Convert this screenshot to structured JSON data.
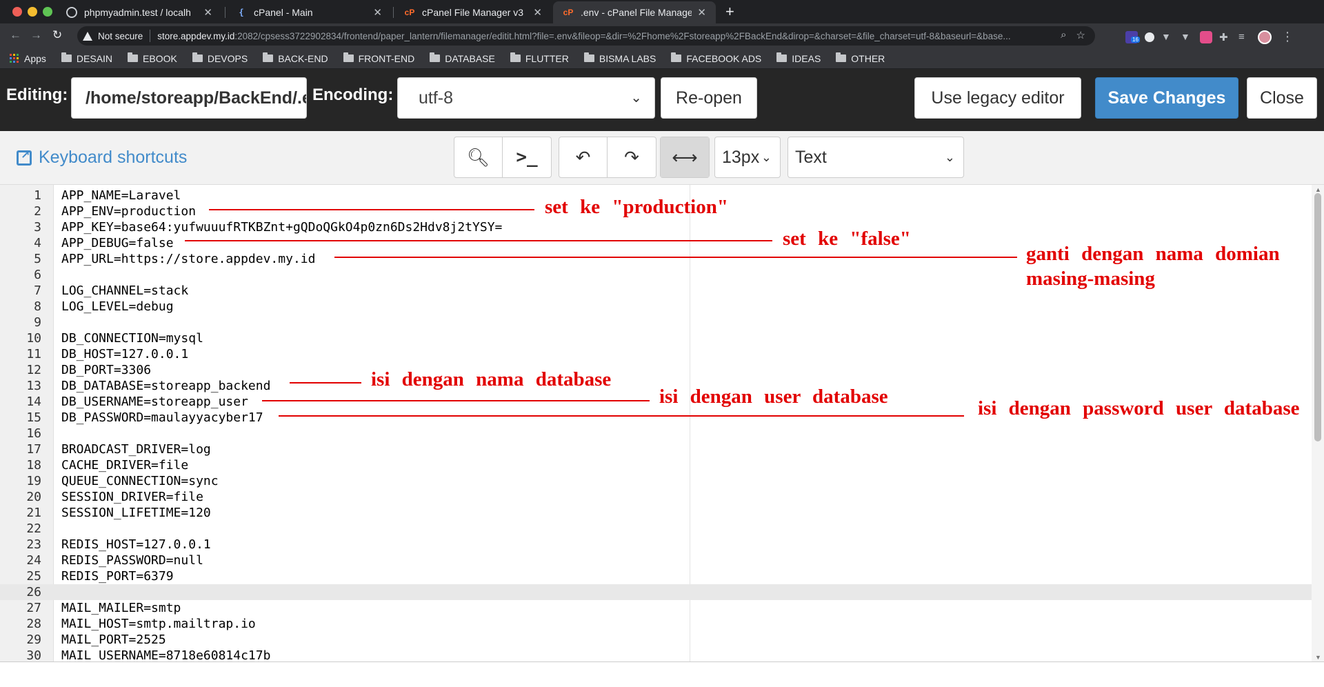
{
  "browser": {
    "tabs": [
      {
        "title": "phpmyadmin.test / localh",
        "icon": "globe-icon"
      },
      {
        "title": "cPanel - Main",
        "icon": "bracket-icon"
      },
      {
        "title": "cPanel File Manager v3",
        "icon": "cpanel-icon"
      },
      {
        "title": ".env - cPanel File Manager",
        "icon": "cpanel-icon",
        "active": true
      }
    ],
    "address": {
      "security": "Not secure",
      "host": "store.appdev.my.id",
      "path": ":2082/cpsess3722902834/frontend/paper_lantern/filemanager/editit.html?file=.env&fileop=&dir=%2Fhome%2Fstoreapp%2FBackEnd&dirop=&charset=&file_charset=utf-8&baseurl=&base..."
    },
    "extension_badge": "16",
    "bookmarks": [
      "Apps",
      "DESAIN",
      "EBOOK",
      "DEVOPS",
      "BACK-END",
      "FRONT-END",
      "DATABASE",
      "FLUTTER",
      "BISMA LABS",
      "FACEBOOK ADS",
      "IDEAS",
      "OTHER"
    ]
  },
  "header": {
    "editing_label": "Editing:",
    "file_path": "/home/storeapp/BackEnd/.env",
    "encoding_label": "Encoding:",
    "encoding_value": "utf-8",
    "reopen": "Re-open",
    "legacy": "Use legacy editor",
    "save": "Save Changes",
    "close": "Close"
  },
  "toolbar": {
    "shortcuts": "Keyboard shortcuts",
    "font_size": "13px",
    "mode": "Text"
  },
  "editor": {
    "active_line": 26,
    "lines": [
      "APP_NAME=Laravel",
      "APP_ENV=production",
      "APP_KEY=base64:yufwuuufRTKBZnt+gQDoQGkO4p0zn6Ds2Hdv8j2tYSY=",
      "APP_DEBUG=false",
      "APP_URL=https://store.appdev.my.id",
      "",
      "LOG_CHANNEL=stack",
      "LOG_LEVEL=debug",
      "",
      "DB_CONNECTION=mysql",
      "DB_HOST=127.0.0.1",
      "DB_PORT=3306",
      "DB_DATABASE=storeapp_backend",
      "DB_USERNAME=storeapp_user",
      "DB_PASSWORD=maulayyacyber17",
      "",
      "BROADCAST_DRIVER=log",
      "CACHE_DRIVER=file",
      "QUEUE_CONNECTION=sync",
      "SESSION_DRIVER=file",
      "SESSION_LIFETIME=120",
      "",
      "REDIS_HOST=127.0.0.1",
      "REDIS_PASSWORD=null",
      "REDIS_PORT=6379",
      "",
      "MAIL_MAILER=smtp",
      "MAIL_HOST=smtp.mailtrap.io",
      "MAIL_PORT=2525",
      "MAIL_USERNAME=8718e60814c17b"
    ]
  },
  "annotations": {
    "app_env": "set ke \"production\"",
    "app_debug": "set ke \"false\"",
    "app_url_1": "ganti dengan nama domian",
    "app_url_2": "masing-masing",
    "db_database": "isi dengan nama database",
    "db_username": "isi dengan user database",
    "db_password": "isi dengan password user database"
  },
  "colors": {
    "annotation": "#e20000",
    "primary_button": "#428bca",
    "header_bg": "#262626",
    "browser_chrome": "#35363a"
  }
}
